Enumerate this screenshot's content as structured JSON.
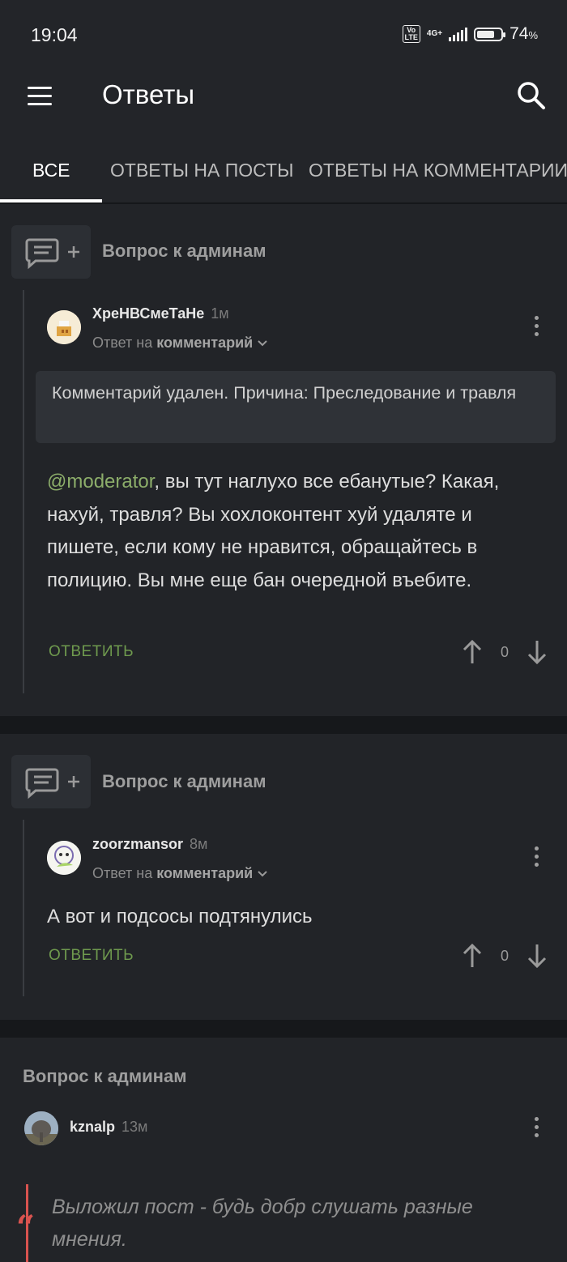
{
  "status_bar": {
    "time": "19:04",
    "volte": "Vo LTE",
    "network": "4G+",
    "battery_percent": "74",
    "battery_percent_sign": "%",
    "battery_level": 0.74
  },
  "app_bar": {
    "title": "Ответы",
    "menu_icon": "hamburger-icon",
    "search_icon": "search-icon"
  },
  "tabs": [
    {
      "label": "ВСЕ",
      "active": true
    },
    {
      "label": "ОТВЕТЫ НА ПОСТЫ",
      "active": false
    },
    {
      "label": "ОТВЕТЫ НА КОММЕНТАРИИ",
      "active": false
    }
  ],
  "cards": [
    {
      "post_title": "Вопрос к админам",
      "comment": {
        "username": "ХреНВСмеТаНе",
        "time": "1м",
        "reply_prefix": "Ответ на",
        "reply_target": "комментарий",
        "deleted_notice": "Комментарий удален. Причина: Преследование и травля",
        "mention": "@moderator",
        "text": ", вы тут наглухо все ебанутые? Какая, нахуй, травля? Вы хохлоконтент хуй удаляте и пишете, если кому не нравится, обращайтесь в полицию. Вы мне еще бан очередной въебите.",
        "reply_label": "ОТВЕТИТЬ",
        "votes": "0"
      }
    },
    {
      "post_title": "Вопрос к админам",
      "comment": {
        "username": "zoorzmansor",
        "time": "8м",
        "reply_prefix": "Ответ на",
        "reply_target": "комментарий",
        "text": "А вот и подсосы подтянулись",
        "reply_label": "ОТВЕТИТЬ",
        "votes": "0"
      }
    },
    {
      "post_title": "Вопрос к админам",
      "comment": {
        "username": "kznalp",
        "time": "13м",
        "quote": "Выложил пост - будь добр слушать разные мнения."
      }
    }
  ]
}
